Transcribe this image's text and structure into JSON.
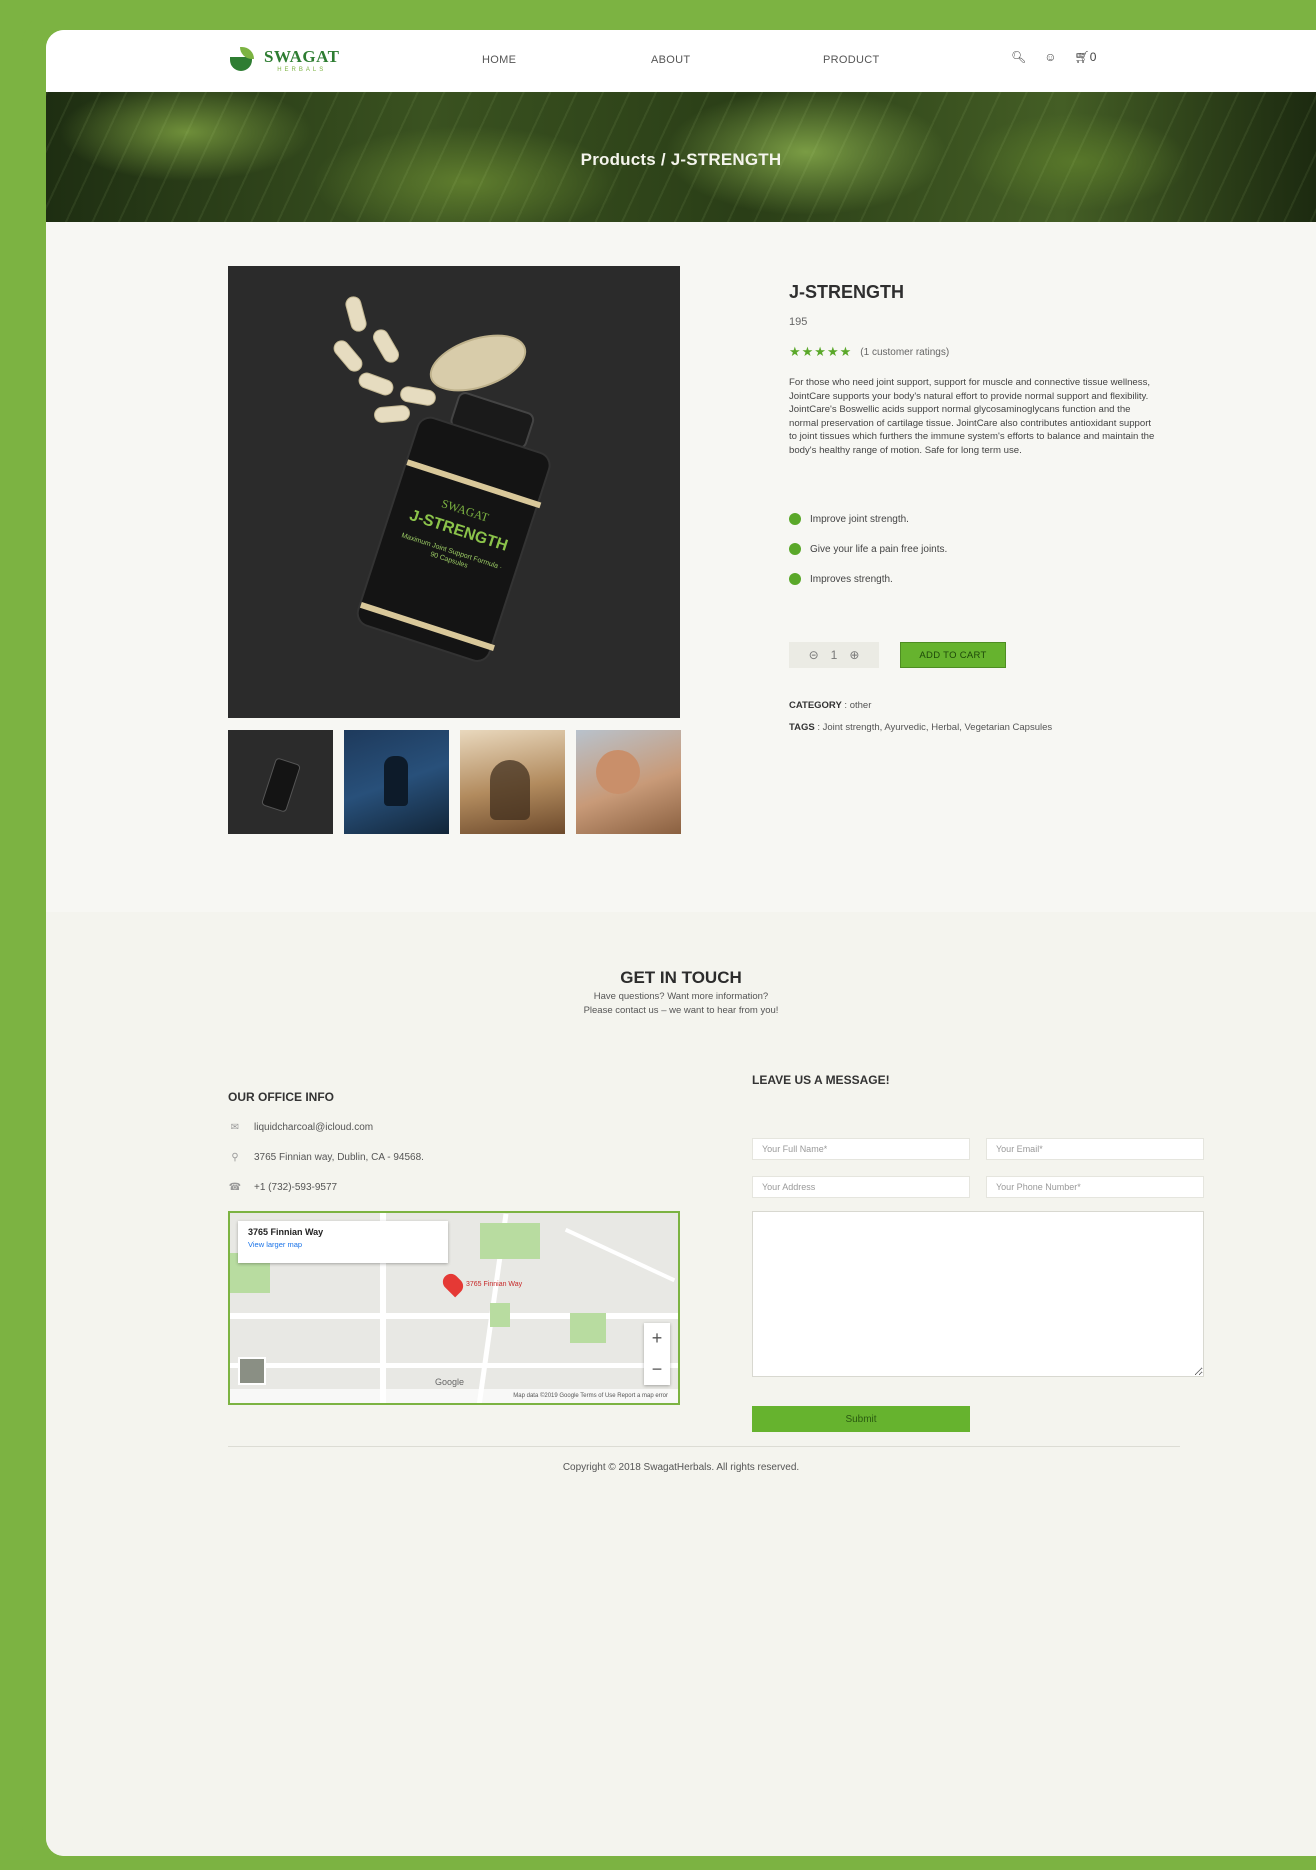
{
  "header": {
    "logo_name": "SWAGAT",
    "logo_sub": "HERBALS",
    "nav": [
      "HOME",
      "ABOUT",
      "PRODUCT"
    ],
    "cart_count": "0"
  },
  "hero": {
    "breadcrumb": "Products / J-STRENGTH"
  },
  "product": {
    "title": "J-STRENGTH",
    "price": "195",
    "stars": "★★★★★",
    "rating": 5,
    "ratings_text": "(1 customer ratings)",
    "description": "For those who need joint support, support for muscle and connective tissue wellness, JointCare supports your body's natural effort to provide normal support and flexibility. JointCare's Boswellic acids support normal glycosaminoglycans function and the normal preservation of cartilage tissue. JointCare also contributes antioxidant support to joint tissues which furthers the immune system's efforts to balance and maintain the body's healthy range of motion. Safe for long term use.",
    "features": [
      "Improve joint strength.",
      "Give your life a pain free joints.",
      "Improves strength."
    ],
    "quantity": "1",
    "add_to_cart": "ADD TO CART",
    "category_label": "CATEGORY",
    "category_value": ": other",
    "tags_label": "TAGS",
    "tags_value": ": Joint strength, Ayurvedic, Herbal, Vegetarian Capsules",
    "image_brand": "SWAGAT",
    "image_label": "J-STRENGTH",
    "image_sub": "Maximum Joint Support Formula · 90 Capsules"
  },
  "contact": {
    "title": "GET IN TOUCH",
    "sub_line1": "Have questions? Want more information?",
    "sub_line2": "Please contact us – we want to hear from you!",
    "office_title": "OUR OFFICE INFO",
    "email": "liquidcharcoal@icloud.com",
    "address": "3765 Finnian way, Dublin, CA - 94568.",
    "phone": "+1 (732)-593-9577",
    "map_card_title": "3765 Finnian Way",
    "map_card_link": "View larger map",
    "map_pin_label": "3765 Finnian Way",
    "map_google": "Google",
    "map_footer": "Map data ©2019 Google    Terms of Use    Report a map error",
    "message_title": "LEAVE US A MESSAGE!",
    "placeholders": {
      "name": "Your Full Name*",
      "email": "Your Email*",
      "address": "Your Address",
      "phone": "Your Phone Number*"
    },
    "submit": "Submit"
  },
  "footer": {
    "copyright": "Copyright © 2018 SwagatHerbals. All rights reserved."
  },
  "colors": {
    "accent": "#7cb342",
    "button": "#66b32e",
    "dark_green": "#2e7d32"
  }
}
